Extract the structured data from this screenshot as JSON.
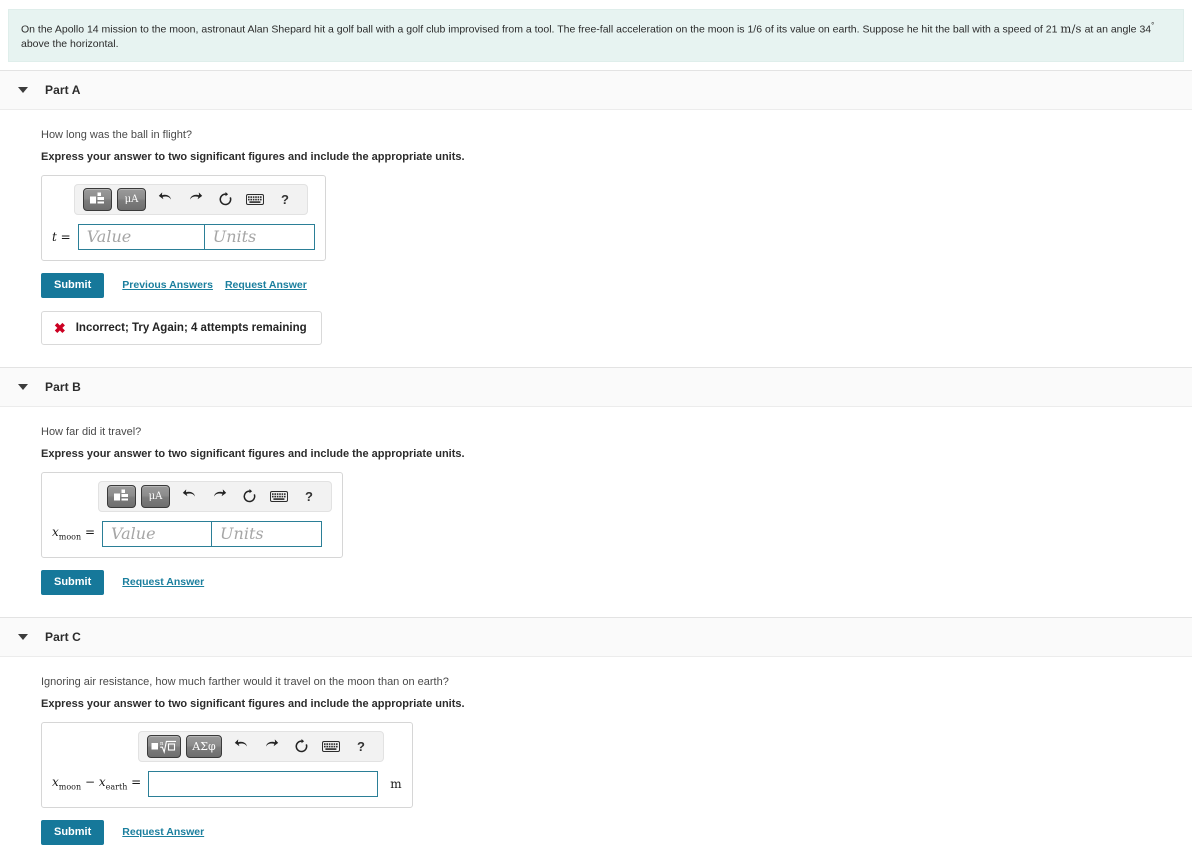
{
  "problem": {
    "text_before_speed": "On the Apollo 14 mission to the moon, astronaut Alan Shepard hit a golf ball with a golf club improvised from a tool. The free-fall acceleration on the moon is 1/6 of its value on earth. Suppose he hit the ball with a speed of 21",
    "speed_unit": "m/s",
    "text_middle": "at an angle 34",
    "degree_symbol": "°",
    "text_after": "above the horizontal."
  },
  "toolbar": {
    "template_icon": "math-template-icon",
    "greek_icon": "greek-letters-icon",
    "undo_icon": "undo-icon",
    "redo_icon": "redo-icon",
    "reset_icon": "reset-icon",
    "keyboard_icon": "keyboard-icon",
    "help_label": "?"
  },
  "common": {
    "instruction": "Express your answer to two significant figures and include the appropriate units.",
    "submit_label": "Submit",
    "previous_answers_label": "Previous Answers",
    "request_answer_label": "Request Answer",
    "value_placeholder": "Value",
    "units_placeholder": "Units",
    "greek_mu_a": "μΑ",
    "greek_asigmaphi": "ΑΣφ"
  },
  "parts": [
    {
      "title": "Part A",
      "question": "How long was the ball in flight?",
      "var_main": "t",
      "var_sub": "",
      "var_eq": "=",
      "value": "",
      "units": "",
      "has_previous_answers": true,
      "feedback": "Incorrect; Try Again; 4 attempts remaining"
    },
    {
      "title": "Part B",
      "question": "How far did it travel?",
      "var_main": "x",
      "var_sub": "moon",
      "var_eq": "=",
      "value": "",
      "units": "",
      "has_previous_answers": false,
      "feedback": ""
    },
    {
      "title": "Part C",
      "question": "Ignoring air resistance, how much farther would it travel on the moon than on earth?",
      "var_main": "x",
      "var_sub": "moon",
      "var_main2": "x",
      "var_sub2": "earth",
      "var_minus": "−",
      "var_eq": "=",
      "value": "",
      "unit_after": "m",
      "has_previous_answers": false,
      "feedback": ""
    }
  ],
  "colors": {
    "banner_bg": "#e7f3f1",
    "accent_teal": "#16789a",
    "error_red": "#cc0022",
    "part_header_bg": "#fafafa"
  }
}
